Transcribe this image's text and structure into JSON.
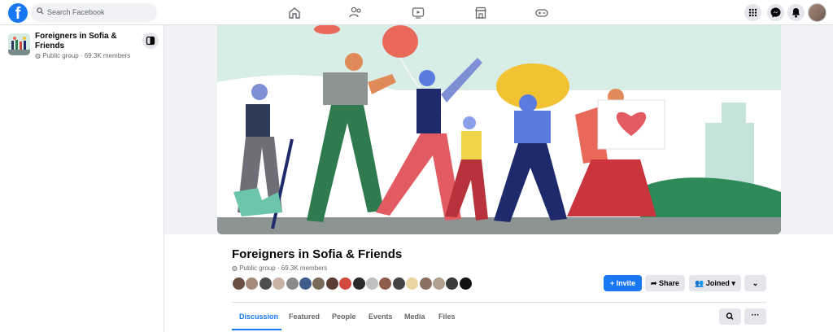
{
  "topbar": {
    "logo_letter": "f",
    "search_placeholder": "Search Facebook",
    "nav_icons": [
      "home-icon",
      "friends-icon",
      "watch-icon",
      "marketplace-icon",
      "gaming-icon"
    ],
    "right_icons": [
      "menu-grid-icon",
      "messenger-icon",
      "notifications-icon",
      "account-avatar"
    ]
  },
  "sidebar": {
    "group_name": "Foreigners in Sofia & Friends",
    "group_meta": "Public group · 69.3K members"
  },
  "group": {
    "title": "Foreigners in Sofia & Friends",
    "meta": "Public group · 69.3K members",
    "member_colors": [
      "#6b4f45",
      "#a58a7c",
      "#4e4e4e",
      "#c9b3a6",
      "#8a8a8a",
      "#3f5d8a",
      "#7a6a5a",
      "#5b3e33",
      "#d24a3f",
      "#2b2b2b",
      "#c0c0c0",
      "#8e5d4a",
      "#444444",
      "#e8d5a0",
      "#8b6f62",
      "#b0a090",
      "#3a3a3a",
      "#111111"
    ],
    "buttons": {
      "invite": "+ Invite",
      "share": "Share",
      "joined": "Joined",
      "more": "⌄"
    },
    "tabs": [
      "Discussion",
      "Featured",
      "People",
      "Events",
      "Media",
      "Files"
    ],
    "active_tab": "Discussion",
    "tab_search_icon": "search-icon",
    "tab_more": "···"
  },
  "colors": {
    "brand": "#1877f2",
    "background": "#f0f2f5",
    "secondary_button": "#e4e6eb"
  }
}
